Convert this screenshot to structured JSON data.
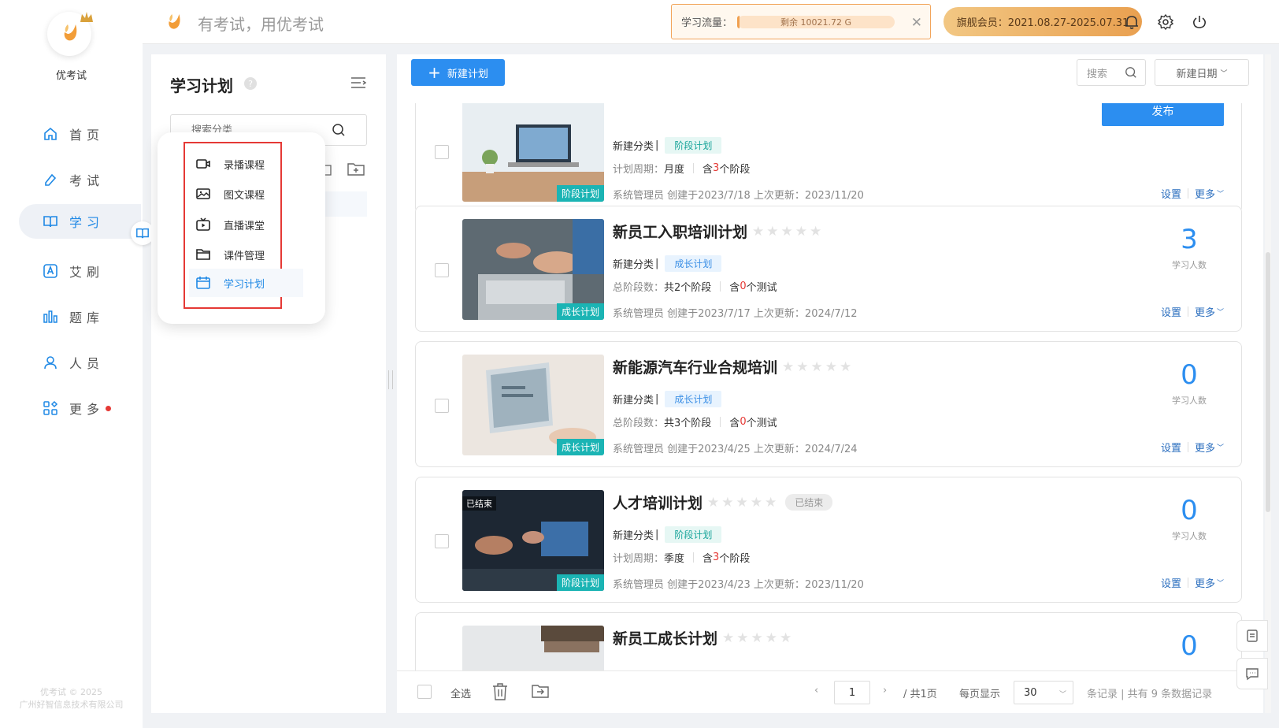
{
  "app": {
    "name": "优考试",
    "slogan": "有考试，用优考试",
    "copyright_line1": "优考试 © 2025",
    "copyright_line2": "广州好智信息技术有限公司"
  },
  "nav": [
    {
      "label": "首页",
      "icon": "home-icon"
    },
    {
      "label": "考试",
      "icon": "pen-icon"
    },
    {
      "label": "学习",
      "icon": "book-icon",
      "active": true
    },
    {
      "label": "艾刷",
      "icon": "a-badge-icon"
    },
    {
      "label": "题库",
      "icon": "bar-chart-icon"
    },
    {
      "label": "人员",
      "icon": "user-icon"
    },
    {
      "label": "更多",
      "icon": "apps-icon",
      "dot": true
    }
  ],
  "header": {
    "traffic_label": "学习流量：",
    "traffic_remaining": "剩余 10021.72 G",
    "membership": "旗舰会员：2021.08.27-2025.07.31"
  },
  "subpanel": {
    "title": "学习计划",
    "search_placeholder": "搜索分类"
  },
  "popup": {
    "items": [
      "录播课程",
      "图文课程",
      "直播课堂",
      "课件管理",
      "学习计划"
    ],
    "selected": "学习计划"
  },
  "toolbar": {
    "new_plan": "新建计划",
    "search": "搜索",
    "sort": "新建日期"
  },
  "plans": [
    {
      "title": "",
      "category_label": "新建分类",
      "tag": "阶段计划",
      "thumb_tag": "阶段计划",
      "meta_label": "计划周期：",
      "meta_value": "月度",
      "meta2_pre": "含",
      "meta2_num": "3",
      "meta2_post": "个阶段",
      "info": "系统管理员 创建于2023/7/18  上次更新：2023/11/20",
      "publish": "发布",
      "set": "设置",
      "more": "更多"
    },
    {
      "title": "新员工入职培训计划",
      "category_label": "新建分类",
      "tag": "成长计划",
      "thumb_tag": "成长计划",
      "meta_label": "总阶段数：",
      "meta_value": "共2个阶段",
      "meta2_pre": "含",
      "meta2_num": "0",
      "meta2_post": "个测试",
      "info": "系统管理员 创建于2023/7/17  上次更新：2024/7/12",
      "count": "3",
      "count_label": "学习人数",
      "set": "设置",
      "more": "更多"
    },
    {
      "title": "新能源汽车行业合规培训",
      "category_label": "新建分类",
      "tag": "成长计划",
      "thumb_tag": "成长计划",
      "meta_label": "总阶段数：",
      "meta_value": "共3个阶段",
      "meta2_pre": "含",
      "meta2_num": "0",
      "meta2_post": "个测试",
      "info": "系统管理员 创建于2023/4/25  上次更新：2024/7/24",
      "count": "0",
      "count_label": "学习人数",
      "set": "设置",
      "more": "更多"
    },
    {
      "title": "人才培训计划",
      "ended": "已结束",
      "category_label": "新建分类",
      "tag": "阶段计划",
      "thumb_tag": "阶段计划",
      "meta_label": "计划周期：",
      "meta_value": "季度",
      "meta2_pre": "含",
      "meta2_num": "3",
      "meta2_post": "个阶段",
      "info": "系统管理员 创建于2023/4/23  上次更新：2023/11/20",
      "count": "0",
      "count_label": "学习人数",
      "set": "设置",
      "more": "更多"
    },
    {
      "title": "新员工成长计划",
      "count": "0"
    }
  ],
  "footer": {
    "select_all": "全选",
    "page": "1",
    "total_pages": "/ 共1页",
    "per_page_label": "每页显示",
    "per_page": "30",
    "records": "条记录 | 共有 9 条数据记录"
  },
  "colors": {
    "primary": "#2c8ef0",
    "accent_red": "#e53935",
    "stage_tag": "#18a49a",
    "growth_tag": "#3b8fe5"
  }
}
